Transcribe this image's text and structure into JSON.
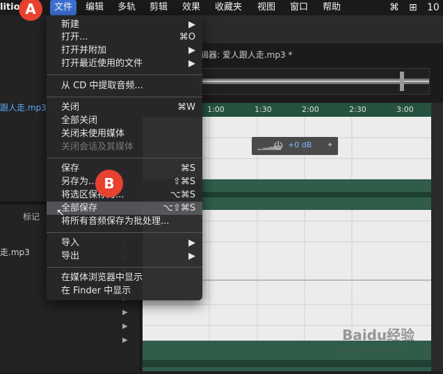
{
  "menubar": {
    "app_fragment": "lition",
    "items": [
      "文件",
      "编辑",
      "多轨",
      "剪辑",
      "效果",
      "收藏夹",
      "视图",
      "窗口",
      "帮助"
    ],
    "clock": "10"
  },
  "badges": {
    "a": "A",
    "b": "B"
  },
  "left": {
    "multitrack_label": "多轨",
    "file1": "跟人走.mp3 *",
    "markers_tab": "标记",
    "file2": "走.mp3"
  },
  "editor": {
    "title": "辑器: 爱人跟人走.mp3 *",
    "ruler_ticks": [
      "1:00",
      "1:30",
      "2:00",
      "2:30",
      "3:00"
    ],
    "hud_gain": "+0 dB"
  },
  "file_menu": {
    "items": [
      {
        "label": "新建",
        "shortcut": "▶",
        "disabled": false
      },
      {
        "label": "打开...",
        "shortcut": "⌘O",
        "disabled": false
      },
      {
        "label": "打开并附加",
        "shortcut": "▶",
        "disabled": false
      },
      {
        "label": "打开最近使用的文件",
        "shortcut": "▶",
        "disabled": false
      },
      {
        "label": "从 CD 中提取音频...",
        "shortcut": "",
        "disabled": false
      },
      {
        "label": "关闭",
        "shortcut": "⌘W",
        "disabled": false
      },
      {
        "label": "全部关闭",
        "shortcut": "",
        "disabled": false
      },
      {
        "label": "关闭未使用媒体",
        "shortcut": "",
        "disabled": false
      },
      {
        "label": "关闭会话及其媒体",
        "shortcut": "",
        "disabled": true
      },
      {
        "label": "保存",
        "shortcut": "⌘S",
        "disabled": false
      },
      {
        "label": "另存为...",
        "shortcut": "⇧⌘S",
        "disabled": false
      },
      {
        "label": "将选区保存为...",
        "shortcut": "⌥⌘S",
        "disabled": false
      },
      {
        "label": "全部保存",
        "shortcut": "⌥⇧⌘S",
        "disabled": false
      },
      {
        "label": "将所有音频保存为批处理...",
        "shortcut": "",
        "disabled": false
      },
      {
        "label": "导入",
        "shortcut": "▶",
        "disabled": false
      },
      {
        "label": "导出",
        "shortcut": "▶",
        "disabled": false
      },
      {
        "label": "在媒体浏览器中显示",
        "shortcut": "",
        "disabled": false
      },
      {
        "label": "在 Finder 中显示",
        "shortcut": "",
        "disabled": false
      }
    ]
  },
  "watermark": {
    "main": "Baidu经验",
    "sub": "jingyan.baidu.com"
  }
}
